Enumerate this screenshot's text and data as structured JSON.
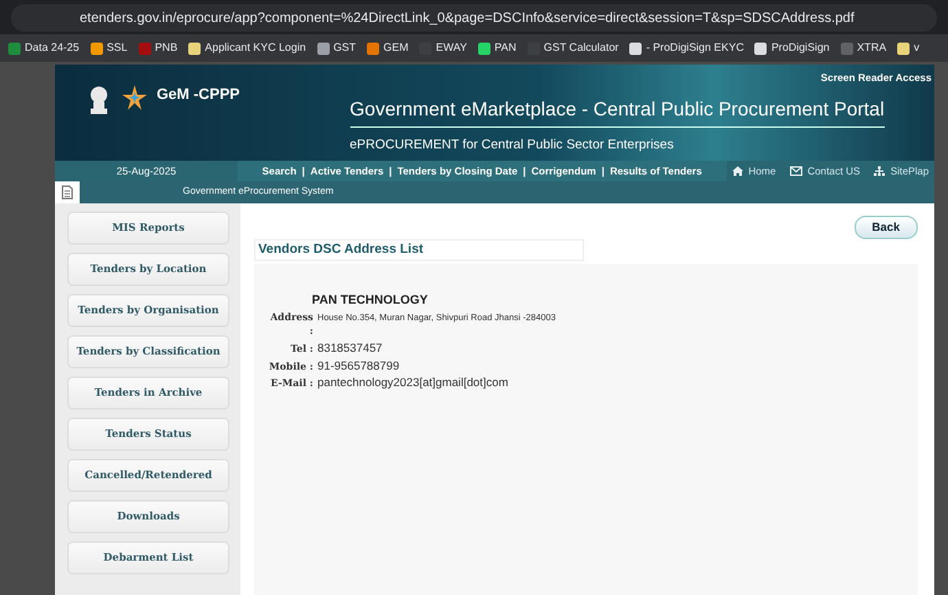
{
  "browser": {
    "url": "etenders.gov.in/eprocure/app?component=%24DirectLink_0&page=DSCInfo&service=direct&session=T&sp=SDSCAddress.pdf",
    "bookmarks": [
      {
        "label": "Data 24-25",
        "color": "#1e8e3e"
      },
      {
        "label": "SSL",
        "color": "#f29900"
      },
      {
        "label": "PNB",
        "color": "#a50e0e"
      },
      {
        "label": "Applicant KYC Login",
        "color": "#e8d27a"
      },
      {
        "label": "GST",
        "color": "#9aa0a6"
      },
      {
        "label": "GEM",
        "color": "#e37400"
      },
      {
        "label": "EWAY",
        "color": "#3c4043"
      },
      {
        "label": "PAN",
        "color": "#25d366"
      },
      {
        "label": "GST Calculator",
        "color": "#3c4043"
      },
      {
        "label": "- ProDigiSign EKYC",
        "color": "#dadce0"
      },
      {
        "label": "ProDigiSign",
        "color": "#dadce0"
      },
      {
        "label": "XTRA",
        "color": "#5f6368"
      },
      {
        "label": "v",
        "color": "#e8d27a"
      }
    ]
  },
  "header": {
    "screen_reader": "Screen Reader Access",
    "logo": "GeM -CPPP",
    "title": "Government eMarketplace - Central Public Procurement Portal",
    "subtitle": "ePROCUREMENT for Central Public Sector Enterprises"
  },
  "navbar": {
    "date": "25-Aug-2025",
    "separator": "|",
    "links": [
      "Search",
      "Active Tenders",
      "Tenders by Closing Date",
      "Corrigendum",
      "Results of Tenders"
    ],
    "right_links": [
      {
        "kind": "home",
        "label": "Home"
      },
      {
        "kind": "contact",
        "label": "Contact US"
      },
      {
        "kind": "sitemap",
        "label": "SitePlap"
      }
    ]
  },
  "subbar": {
    "label": "Government eProcurement System"
  },
  "sidebar": {
    "items": [
      "MIS Reports",
      "Tenders by Location",
      "Tenders by Organisation",
      "Tenders by Classification",
      "Tenders in Archive",
      "Tenders Status",
      "Cancelled/Retendered",
      "Downloads",
      "Debarment List"
    ]
  },
  "content": {
    "back": "Back",
    "heading": "Vendors DSC Address List",
    "vendor": "PAN TECHNOLOGY",
    "fields": [
      {
        "label": "Address :",
        "value": "House No.354, Muran Nagar, Shivpuri Road Jhansi -284003",
        "kind": "small"
      },
      {
        "label": "Tel :",
        "value": "8318537457",
        "kind": "normal"
      },
      {
        "label": "Mobile :",
        "value": "91-9565788799",
        "kind": "normal"
      },
      {
        "label": "E-Mail :",
        "value": "pantechnology2023[at]gmail[dot]com",
        "kind": "normal"
      }
    ]
  }
}
